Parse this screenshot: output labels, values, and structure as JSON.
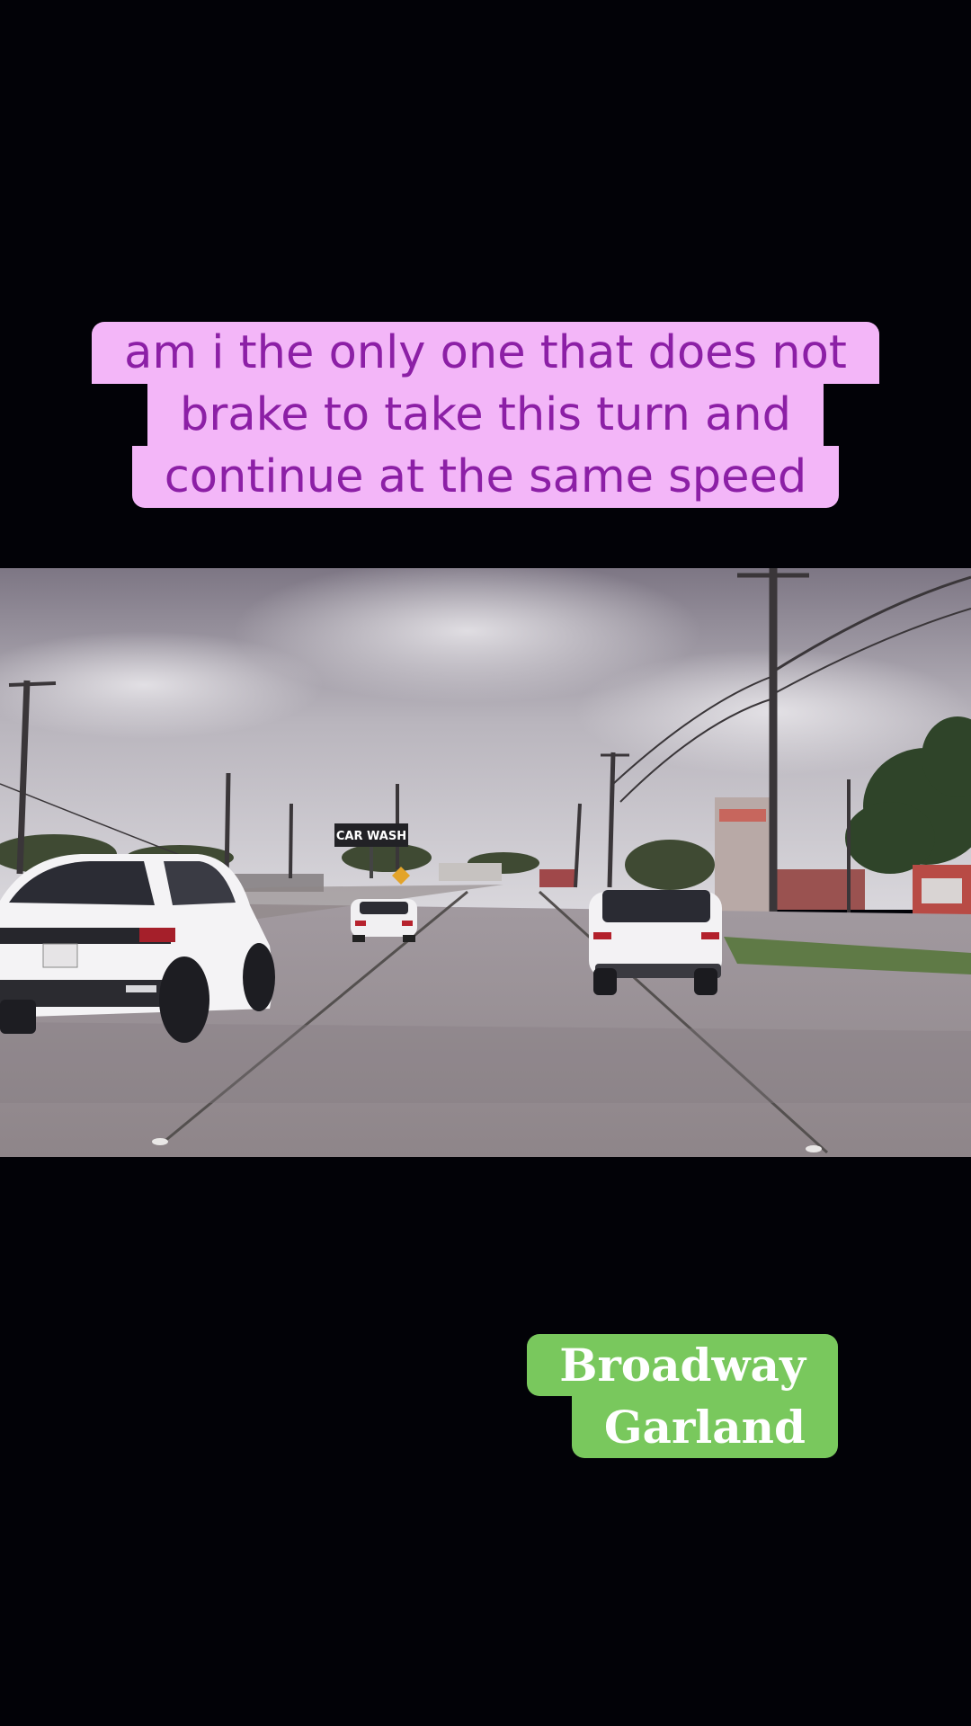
{
  "caption": {
    "lines": [
      "am i the only one that does not",
      "brake to take this turn and",
      "continue at the same speed"
    ]
  },
  "location_tag": {
    "lines": [
      "Broadway",
      "Garland"
    ]
  },
  "video": {
    "sign_text": "CAR WASH"
  },
  "colors": {
    "background": "#020207",
    "caption_bg": "#f3b6f8",
    "caption_text": "#8c1fa6",
    "location_bg": "#79c85d",
    "location_text": "#ffffff"
  }
}
